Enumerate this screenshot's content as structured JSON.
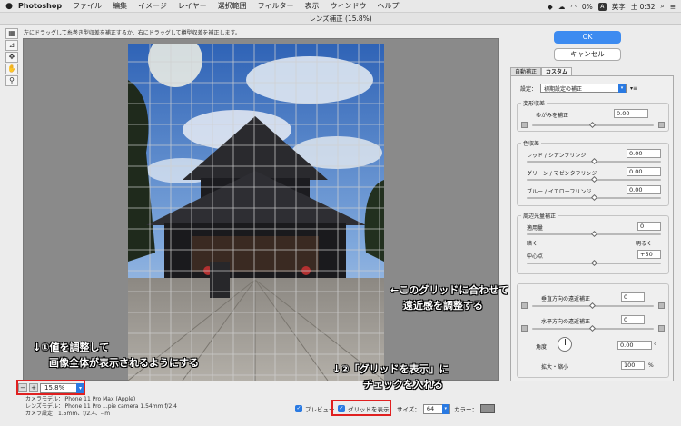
{
  "menubar": {
    "apple": "",
    "app": "Photoshop",
    "items": [
      "ファイル",
      "編集",
      "イメージ",
      "レイヤー",
      "選択範囲",
      "フィルター",
      "表示",
      "ウィンドウ",
      "ヘルプ"
    ],
    "battery": "0%",
    "input": "英字",
    "time": "土 0:32"
  },
  "dialog": {
    "title": "レンズ補正 (15.8%)",
    "hint": "左にドラッグして糸巻き型収差を補正するか、右にドラッグして樽型収差を補正します。",
    "zoom": "15.8%",
    "camera_model": "カメラモデル：iPhone 11 Pro Max (Apple)",
    "lens_model": "レンズモデル：iPhone 11 Pro ...pie camera 1.54mm f/2.4",
    "camera_settings": "カメラ設定：1.5mm、f/2.4、--m",
    "preview_label": "プレビュー",
    "show_grid_label": "グリッドを表示",
    "size_label": "サイズ：",
    "size_value": "64",
    "color_label": "カラー：",
    "grid_color": "#8f8f8f"
  },
  "buttons": {
    "ok": "OK",
    "cancel": "キャンセル"
  },
  "tabs": [
    "自動補正",
    "カスタム"
  ],
  "panel": {
    "settings_label": "設定：",
    "settings_value": "初期設定の補正",
    "distortion": {
      "group": "変形収差",
      "label": "ゆがみを補正",
      "value": "0.00"
    },
    "chroma": {
      "group": "色収差",
      "items": [
        {
          "label": "レッド / シアンフリンジ",
          "value": "0.00"
        },
        {
          "label": "グリーン / マゼンタフリンジ",
          "value": "0.00"
        },
        {
          "label": "ブルー / イエローフリンジ",
          "value": "0.00"
        }
      ]
    },
    "vignette": {
      "group": "周辺光量補正",
      "amount_label": "適用量",
      "amount_value": "0",
      "darken": "暗く",
      "lighten": "明るく",
      "midpoint_label": "中心点",
      "midpoint_value": "+50"
    },
    "transform": {
      "vertical_label": "垂直方向の遠近補正",
      "vertical_value": "0",
      "horizontal_label": "水平方向の遠近補正",
      "horizontal_value": "0",
      "angle_label": "角度：",
      "angle_value": "0.00",
      "angle_unit": "°",
      "scale_label": "拡大・縮小",
      "scale_value": "100",
      "scale_unit": "%"
    }
  },
  "annotations": {
    "grid_note_1": "←このグリッドに合わせて",
    "grid_note_2": "遠近感を調整する",
    "zoom_note_1": "↓①値を調整して",
    "zoom_note_2": "画像全体が表示されるようにする",
    "check_note_1": "↓②「グリッドを表示」に",
    "check_note_2": "チェックを入れる"
  },
  "colors": {
    "accent": "#2a7ae2",
    "annotation_box": "#e02020"
  }
}
